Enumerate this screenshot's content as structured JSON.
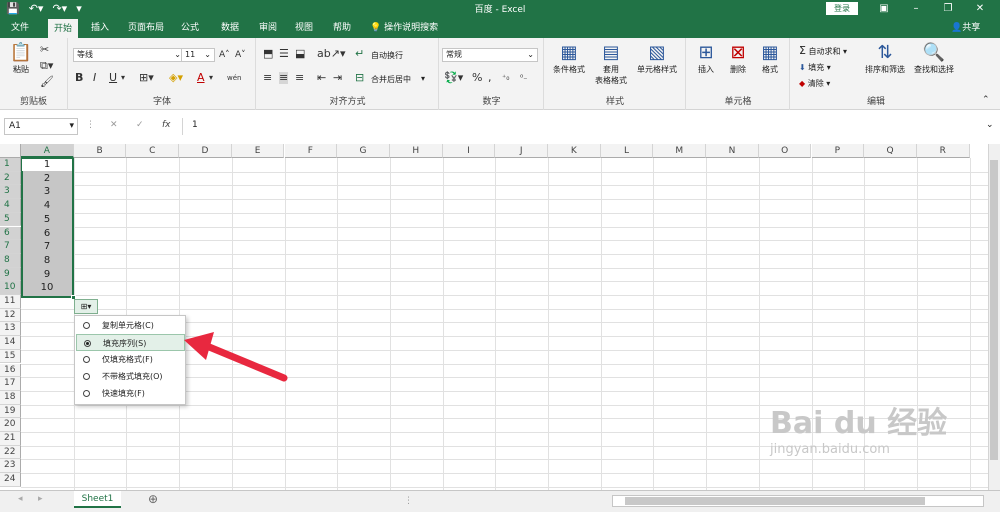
{
  "title": "百度 - Excel",
  "login": "登录",
  "tabs": [
    "文件",
    "开始",
    "插入",
    "页面布局",
    "公式",
    "数据",
    "审阅",
    "视图",
    "帮助"
  ],
  "search_text": "操作说明搜索",
  "share": "共享",
  "clipboard": {
    "label": "剪贴板",
    "paste": "粘贴"
  },
  "font": {
    "label": "字体",
    "name": "等线",
    "size": "11",
    "bold": "B",
    "italic": "I",
    "underline": "U",
    "grow": "A˄",
    "shrink": "A˅",
    "color": "A",
    "wen": "wén"
  },
  "align": {
    "label": "对齐方式",
    "wrap": "自动换行",
    "merge": "合并后居中"
  },
  "number": {
    "label": "数字",
    "format": "常规"
  },
  "styles": {
    "label": "样式",
    "cond": "条件格式",
    "table1": "套用",
    "table2": "表格格式",
    "cellstyle": "单元格样式"
  },
  "cells": {
    "label": "单元格",
    "insert": "插入",
    "delete": "删除",
    "format": "格式"
  },
  "editing": {
    "label": "编辑",
    "autosum": "自动求和",
    "fill": "填充",
    "clear": "清除",
    "sort": "排序和筛选",
    "find": "查找和选择"
  },
  "formula": {
    "namebox": "A1",
    "x": "✕",
    "check": "✓",
    "fx": "fx",
    "value": "1"
  },
  "columns": [
    "A",
    "B",
    "C",
    "D",
    "E",
    "F",
    "G",
    "H",
    "I",
    "J",
    "K",
    "L",
    "M",
    "N",
    "O",
    "P",
    "Q",
    "R"
  ],
  "rows": [
    "1",
    "2",
    "3",
    "4",
    "5",
    "6",
    "7",
    "8",
    "9",
    "10",
    "11",
    "12",
    "13",
    "14",
    "15",
    "16",
    "17",
    "18",
    "19",
    "20",
    "21",
    "22",
    "23",
    "24"
  ],
  "cell_values": [
    "1",
    "2",
    "3",
    "4",
    "5",
    "6",
    "7",
    "8",
    "9",
    "10"
  ],
  "autofill_menu": [
    {
      "label": "复制单元格(C)",
      "checked": false
    },
    {
      "label": "填充序列(S)",
      "checked": true
    },
    {
      "label": "仅填充格式(F)",
      "checked": false
    },
    {
      "label": "不带格式填充(O)",
      "checked": false
    },
    {
      "label": "快速填充(F)",
      "checked": false
    }
  ],
  "sheet_tab": "Sheet1",
  "add_sheet": "⊕",
  "watermark": {
    "brand": "Bai du 经验",
    "url": "jingyan.baidu.com"
  },
  "colors": {
    "accent": "#217346",
    "arrow": "#e8283f"
  }
}
